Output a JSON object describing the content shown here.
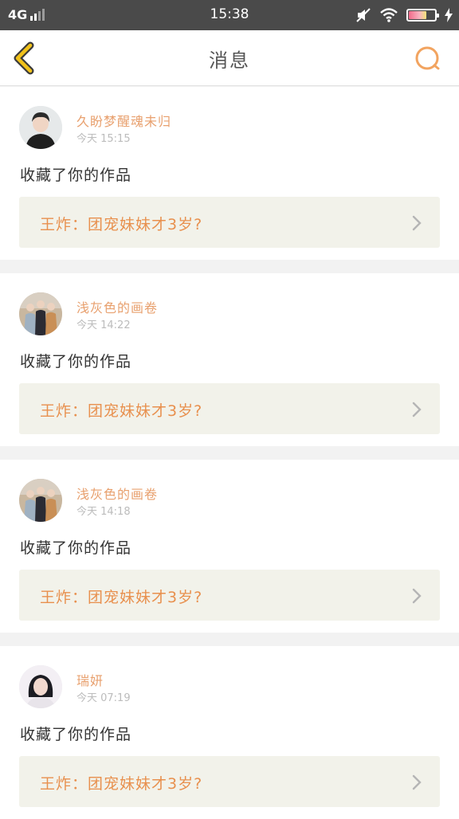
{
  "status_bar": {
    "network": "4G",
    "time": "15:38"
  },
  "header": {
    "title": "消息"
  },
  "colors": {
    "accent_orange": "#e8904e",
    "back_arrow": "#f1c21b",
    "username": "#e8a06e"
  },
  "notifications": [
    {
      "username": "久盼梦醒魂未归",
      "time": "今天  15:15",
      "action": "收藏了你的作品",
      "work_title": "王炸：团宠妹妹才3岁?"
    },
    {
      "username": "浅灰色的画卷",
      "time": "今天  14:22",
      "action": "收藏了你的作品",
      "work_title": "王炸：团宠妹妹才3岁?"
    },
    {
      "username": "浅灰色的画卷",
      "time": "今天  14:18",
      "action": "收藏了你的作品",
      "work_title": "王炸：团宠妹妹才3岁?"
    },
    {
      "username": "瑞妍",
      "time": "今天  07:19",
      "action": "收藏了你的作品",
      "work_title": "王炸：团宠妹妹才3岁?"
    }
  ]
}
